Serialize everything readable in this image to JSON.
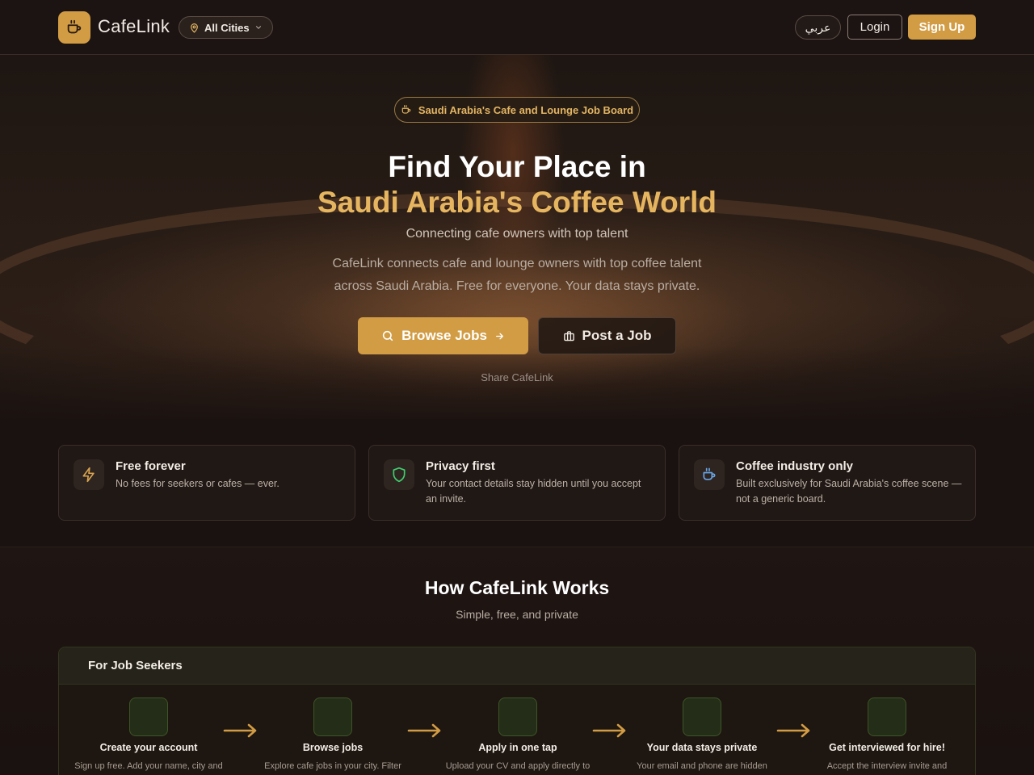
{
  "nav": {
    "brand": "CafeLink",
    "city_selector": "All Cities",
    "language_toggle": "عربي",
    "login_label": "Login",
    "signup_label": "Sign Up"
  },
  "hero": {
    "badge": "Saudi Arabia's Cafe and Lounge Job Board",
    "headline_line1": "Find Your Place in",
    "headline_line2": "Saudi Arabia's Coffee World",
    "tagline": "Connecting cafe owners with top talent",
    "description": "CafeLink connects cafe and lounge owners with top coffee talent across Saudi Arabia. Free for everyone. Your data stays private.",
    "browse_label": "Browse Jobs",
    "post_label": "Post a Job",
    "share_label": " Share CafeLink"
  },
  "features": [
    {
      "icon": "lightning-icon",
      "title": "Free forever",
      "description": "No fees for seekers or cafes — ever."
    },
    {
      "icon": "shield-icon",
      "title": "Privacy first",
      "description": "Your contact details stay hidden until you accept an invite."
    },
    {
      "icon": "coffee-cup-icon",
      "title": "Coffee industry only",
      "description": "Built exclusively for Saudi Arabia's coffee scene — not a generic board."
    }
  ],
  "how_it_works": {
    "title": "How CafeLink Works",
    "subtitle": "Simple, free, and private",
    "seekers_panel": {
      "icon_glyph": "",
      "title": "For Job Seekers",
      "steps": [
        {
          "glyph": "",
          "title": "Create your account",
          "description": "Sign up free. Add your name, city and"
        },
        {
          "glyph": "",
          "title": "Browse jobs",
          "description": "Explore cafe jobs in your city. Filter"
        },
        {
          "glyph": "",
          "title": "Apply in one tap",
          "description": "Upload your CV and apply directly to"
        },
        {
          "glyph": "",
          "title": "Your data stays private",
          "description": "Your email and phone are hidden"
        },
        {
          "glyph": "",
          "title": "Get interviewed for hire!",
          "description": "Accept the interview invite and"
        }
      ]
    }
  },
  "colors": {
    "accent": "#d29c44",
    "accent_text": "#e6b55f",
    "background": "#1a1210",
    "success_green": "#3e5526"
  }
}
